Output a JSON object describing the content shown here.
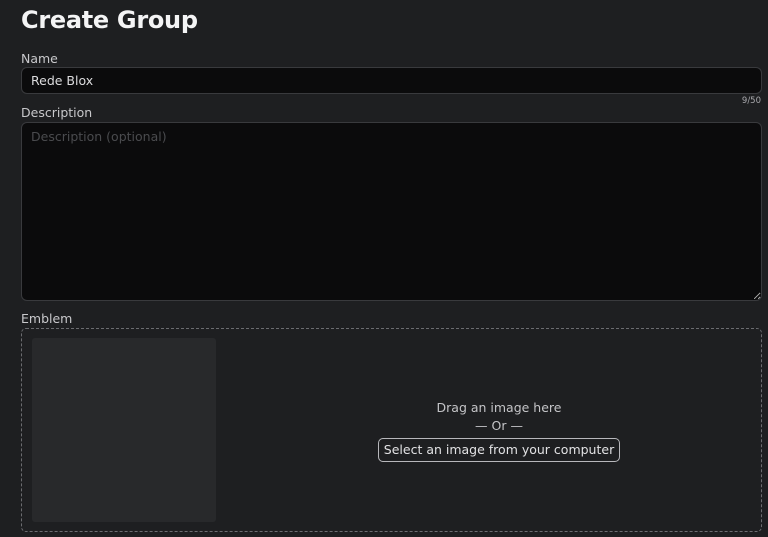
{
  "page": {
    "title": "Create Group"
  },
  "form": {
    "name": {
      "label": "Name",
      "value": "Rede Blox",
      "char_count": "9/50"
    },
    "description": {
      "label": "Description",
      "placeholder": "Description (optional)"
    },
    "emblem": {
      "label": "Emblem",
      "drag_text": "Drag an image here",
      "or_text": "— Or —",
      "select_button_label": "Select an image from your computer"
    }
  },
  "colors": {
    "background": "#1e1f21",
    "input_background": "#0b0b0c",
    "border": "#393a3d"
  }
}
